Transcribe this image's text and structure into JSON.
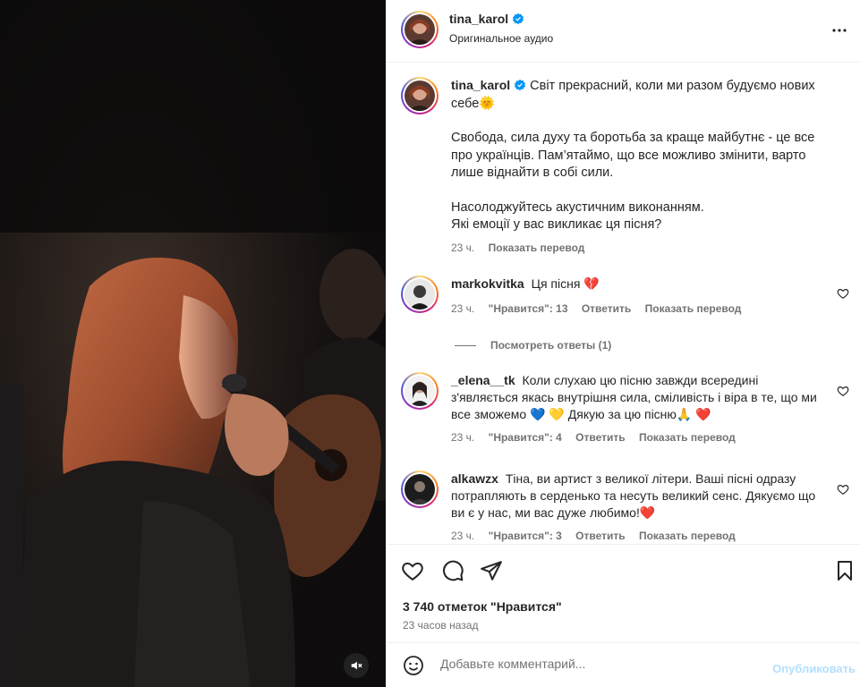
{
  "header": {
    "username": "tina_karol",
    "subtitle": "Оригинальное аудио",
    "verified_color": "#0095f6"
  },
  "caption": {
    "username": "tina_karol",
    "line1": "Світ прекрасний, коли ми разом будуємо нових себе",
    "emoji1": "🌞",
    "para2": "Свобода, сила духу та боротьба за краще майбутнє - це все про українців. Пам’ятаймо, що все можливо змінити, варто лише віднайти в собі сили.",
    "para3a": "Насолоджуйтесь акустичним виконанням.",
    "para3b": "Які емоції у вас викликає ця пісня?",
    "time": "23 ч.",
    "translate": "Показать перевод"
  },
  "comments": [
    {
      "username": "markokvitka",
      "text": "Ця пісня",
      "emoji": "💔",
      "time": "23 ч.",
      "likes": "\"Нравится\": 13",
      "reply": "Ответить",
      "translate": "Показать перевод"
    },
    {
      "username": "_elena__tk",
      "text_a": "Коли слухаю цю пісню завжди всередині з'являється якась внутрішня сила, сміливість і віра в те, що ми все зможемо",
      "emoji_a": "💙",
      "emoji_b": "💛",
      "text_b": "Дякую за цю пісню",
      "emoji_c": "🙏",
      "emoji_d": "❤️",
      "time": "23 ч.",
      "likes": "\"Нравится\": 4",
      "reply": "Ответить",
      "translate": "Показать перевод"
    },
    {
      "username": "alkawzx",
      "text": "Тіна, ви артист з великої літери. Ваші пісні одразу потрапляють в серденько та несуть великий сенс. Дякуємо що ви є у нас, ми вас дуже любимо!",
      "emoji": "❤️",
      "time": "23 ч.",
      "likes": "\"Нравится\": 3",
      "reply": "Ответить",
      "translate": "Показать перевод"
    }
  ],
  "view_replies": "Посмотреть ответы (1)",
  "actions": {
    "likes": "3 740 отметок \"Нравится\"",
    "timeago": "23 часов назад"
  },
  "add_comment": {
    "placeholder": "Добавьте комментарий...",
    "publish": "Опубликовать"
  },
  "icons": {
    "more": "more-horizontal-icon",
    "like": "heart-icon",
    "comment": "comment-icon",
    "share": "share-icon",
    "save": "bookmark-icon",
    "emoji": "emoji-icon",
    "mute": "muted-speaker-icon",
    "verified": "verified-badge-icon"
  }
}
